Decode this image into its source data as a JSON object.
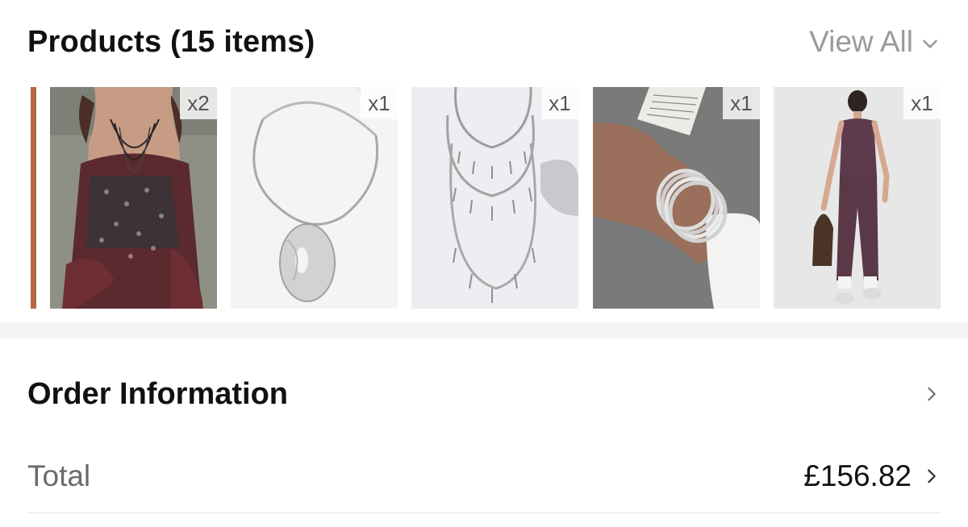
{
  "products_section": {
    "title": "Products (15 items)",
    "view_all_label": "View All",
    "items": [
      {
        "name": "embellished-ruffle-cami",
        "quantity": "x2"
      },
      {
        "name": "silver-pendant-collar",
        "quantity": "x1"
      },
      {
        "name": "layered-leaf-necklace",
        "quantity": "x1"
      },
      {
        "name": "beaded-stretch-bracelets",
        "quantity": "x1"
      },
      {
        "name": "plum-jumpsuit",
        "quantity": "x1"
      }
    ]
  },
  "order_information": {
    "title": "Order Information"
  },
  "total": {
    "label": "Total",
    "value": "£156.82"
  },
  "colors": {
    "muted_text": "#9a9a9a",
    "label_gray": "#6a6a6a",
    "divider": "#f3f3f3"
  }
}
